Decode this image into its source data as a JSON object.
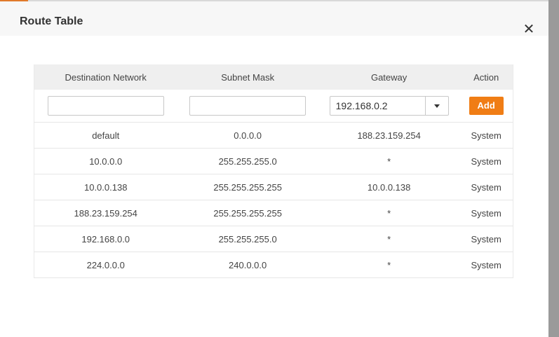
{
  "dialog": {
    "title": "Route Table",
    "close_label": "✕"
  },
  "columns": [
    "Destination Network",
    "Subnet Mask",
    "Gateway",
    "Action"
  ],
  "form": {
    "destination_value": "",
    "mask_value": "",
    "gateway_selected": "192.168.0.2",
    "add_label": "Add"
  },
  "rows": [
    {
      "dest": "default",
      "mask": "0.0.0.0",
      "gw": "188.23.159.254",
      "action": "System"
    },
    {
      "dest": "10.0.0.0",
      "mask": "255.255.255.0",
      "gw": "*",
      "action": "System"
    },
    {
      "dest": "10.0.0.138",
      "mask": "255.255.255.255",
      "gw": "10.0.0.138",
      "action": "System"
    },
    {
      "dest": "188.23.159.254",
      "mask": "255.255.255.255",
      "gw": "*",
      "action": "System"
    },
    {
      "dest": "192.168.0.0",
      "mask": "255.255.255.0",
      "gw": "*",
      "action": "System"
    },
    {
      "dest": "224.0.0.0",
      "mask": "240.0.0.0",
      "gw": "*",
      "action": "System"
    }
  ],
  "colors": {
    "accent": "#f07d15",
    "header_bg": "#efefef"
  }
}
